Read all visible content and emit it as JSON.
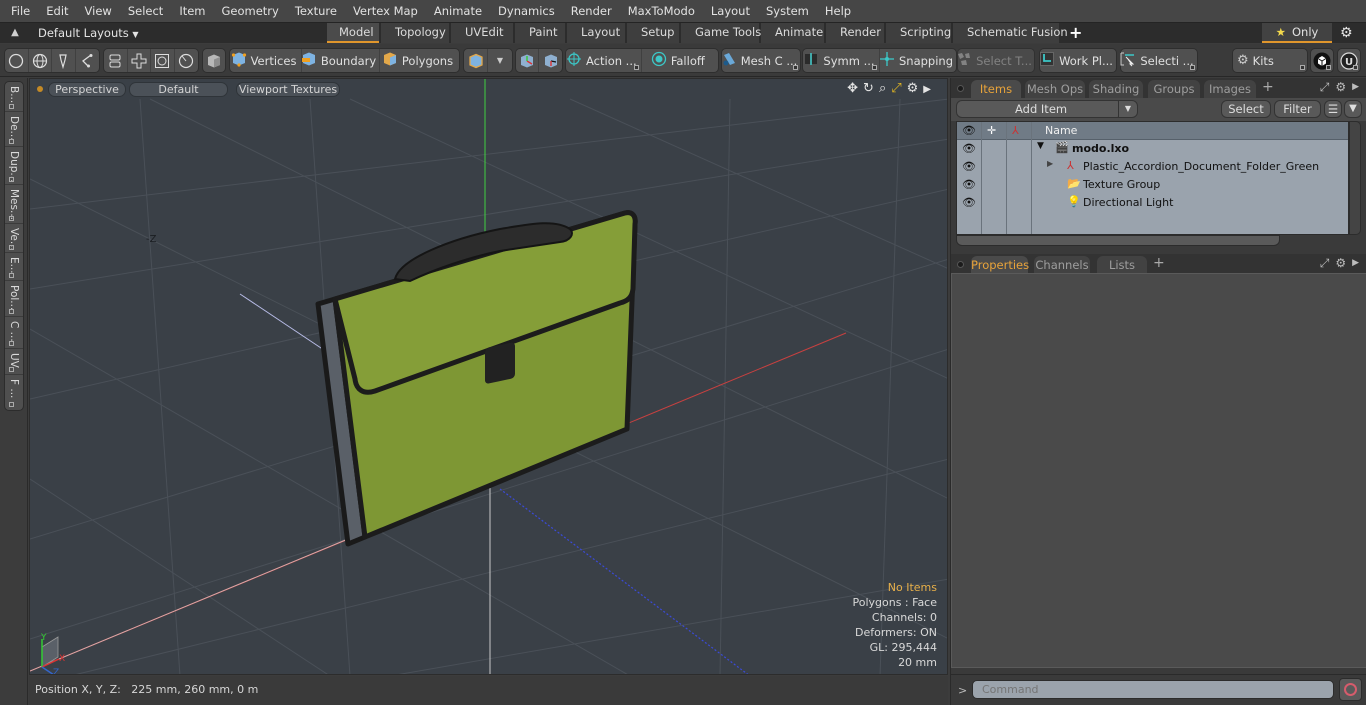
{
  "menubar": {
    "items": [
      "File",
      "Edit",
      "View",
      "Select",
      "Item",
      "Geometry",
      "Texture",
      "Vertex Map",
      "Animate",
      "Dynamics",
      "Render",
      "MaxToModo",
      "Layout",
      "System",
      "Help"
    ]
  },
  "layoutbar": {
    "layout_select": "Default Layouts",
    "tabs": [
      "Model",
      "Topology",
      "UVEdit",
      "Paint",
      "Layout",
      "Setup",
      "Game Tools",
      "Animate",
      "Render",
      "Scripting",
      "Schematic Fusion"
    ],
    "active_tab": "Model",
    "only_label": "Only"
  },
  "toolbar": {
    "vertices": "Vertices",
    "boundary": "Boundary",
    "polygons": "Polygons",
    "action": "Action",
    "falloff": "Falloff",
    "mesh_c": "Mesh C ...",
    "symm": "Symm ...",
    "snapping": "Snapping",
    "select_t": "Select T...",
    "work_pl": "Work Pl...",
    "selecti": "Selecti ...",
    "kits": "Kits",
    "ellipsis": "..."
  },
  "left_strip": {
    "tabs": [
      "B...",
      "De...",
      "Dup...",
      "Mes...",
      "Ve...",
      "E...",
      "Pol...",
      "C ...",
      "UV",
      "F ..."
    ]
  },
  "viewport": {
    "view_mode": "Perspective",
    "shading": "Default",
    "textures": "Viewport Textures",
    "minus_z_label": "-Z",
    "info": {
      "selection": "No Items",
      "polygons": "Polygons : Face",
      "channels": "Channels: 0",
      "deformers": "Deformers: ON",
      "gl": "GL: 295,444",
      "grid": "20 mm"
    },
    "axis_labels": {
      "x": "X",
      "y": "Y",
      "z": "Z"
    },
    "model_color": "#7e9734"
  },
  "statusbar": {
    "position": "Position X, Y, Z:   225 mm, 260 mm, 0 m"
  },
  "items_panel": {
    "tabs": [
      "Items",
      "Mesh Ops",
      "Shading",
      "Groups",
      "Images"
    ],
    "active_tab": "Items",
    "add_item": "Add Item",
    "select": "Select",
    "filter": "Filter",
    "column_name": "Name",
    "tree": [
      {
        "label": "modo.lxo",
        "icon": "scene-icon",
        "level": 0,
        "expanded": true
      },
      {
        "label": "Plastic_Accordion_Document_Folder_Green",
        "icon": "mesh-locator-icon",
        "level": 1,
        "expanded": false
      },
      {
        "label": "Texture Group",
        "icon": "folder-icon",
        "level": 1
      },
      {
        "label": "Directional Light",
        "icon": "light-icon",
        "level": 1
      }
    ]
  },
  "properties_panel": {
    "tabs": [
      "Properties",
      "Channels",
      "Lists"
    ],
    "active_tab": "Properties"
  },
  "command": {
    "prompt": ">",
    "placeholder": "Command"
  },
  "colors": {
    "accent": "#e0962c",
    "x_axis": "#d23a3a",
    "y_axis": "#3ad23a",
    "z_axis": "#3a4ad2"
  }
}
